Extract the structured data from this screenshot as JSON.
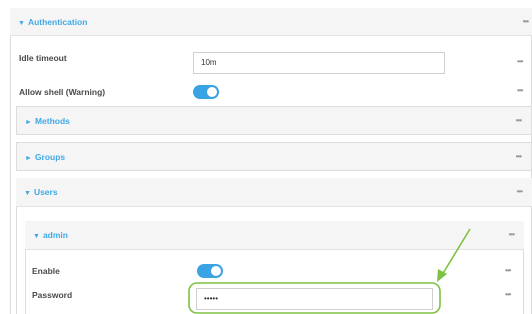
{
  "authentication": {
    "title": "Authentication",
    "idle_timeout_label": "Idle timeout",
    "idle_timeout_value": "10m",
    "allow_shell_label": "Allow shell (Warning)",
    "allow_shell_enabled": true
  },
  "methods": {
    "title": "Methods"
  },
  "groups": {
    "title": "Groups"
  },
  "users": {
    "title": "Users",
    "admin": {
      "title": "admin",
      "enable_label": "Enable",
      "enable_enabled": true,
      "password_label": "Password",
      "password_value": "•••••"
    }
  },
  "glyphs": {
    "caret_down": "▼",
    "caret_right": "►",
    "more": "•••"
  },
  "colors": {
    "accent_blue": "#3fa9e6",
    "toggle_blue": "#3aa3e3",
    "highlight_green": "#7dc242"
  }
}
